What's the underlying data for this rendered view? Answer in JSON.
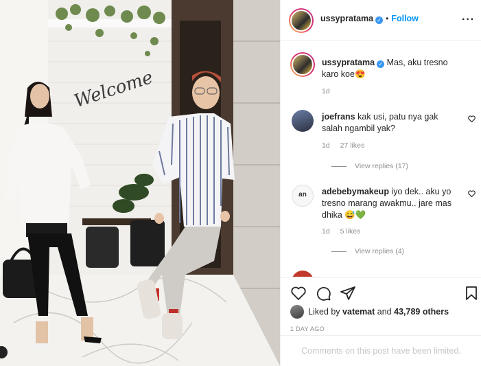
{
  "post": {
    "username": "ussypratama",
    "follow_label": "Follow",
    "dot": "•",
    "more": "···"
  },
  "caption": {
    "username": "ussypratama",
    "text": "Mas, aku tresno karo koe😍",
    "time": "1d"
  },
  "comments": [
    {
      "username": "joefrans",
      "text": "kak usi, patu nya gak salah ngambil yak?",
      "time": "1d",
      "likes": "27 likes",
      "view_replies": "View replies (17)"
    },
    {
      "username": "adebebymakeup",
      "text": "iyo dek.. aku yo tresno marang awakmu.. jare mas dhika 😅💚",
      "time": "1d",
      "likes": "5 likes",
      "view_replies": "View replies (4)"
    }
  ],
  "photo": {
    "sign_text": "Welcome"
  },
  "liked_by": {
    "prefix": "Liked by",
    "user": "vatemat",
    "and": "and",
    "count": "43,789 others"
  },
  "time_ago": "1 DAY AGO",
  "comments_limited": "Comments on this post have been limited.",
  "colors": {
    "accent": "#0095f6",
    "verified": "#3897f0",
    "muted": "#8e8e8e"
  },
  "icons": [
    "heart-icon",
    "comment-icon",
    "share-icon",
    "bookmark-icon",
    "more-icon",
    "verified-icon"
  ]
}
